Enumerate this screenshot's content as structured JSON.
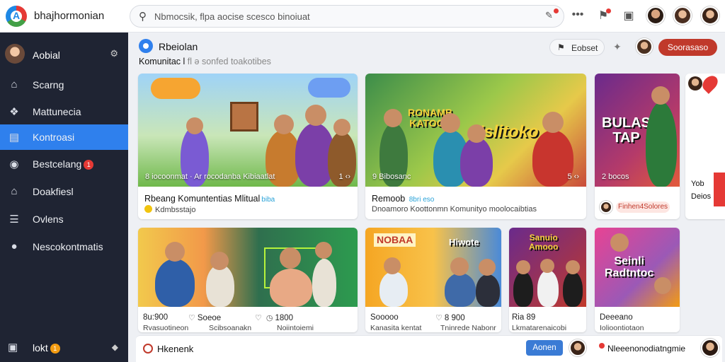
{
  "app": {
    "title": "bhajhormonian",
    "logo_letter": "A"
  },
  "search": {
    "value": "Nbmocsik, flpa aocise scesco binoiuat"
  },
  "sidebar": {
    "user_label": "Aobial",
    "items": [
      {
        "label": "Scarng",
        "icon": "home-icon"
      },
      {
        "label": "Mattunecia",
        "icon": "puzzle-icon"
      },
      {
        "label": "Kontroasi",
        "icon": "square-icon",
        "active": true
      },
      {
        "label": "Bestcelang",
        "icon": "camera-icon",
        "badge": "1"
      },
      {
        "label": "Doakfiesl",
        "icon": "house-icon"
      },
      {
        "label": "Ovlens",
        "icon": "list-icon"
      },
      {
        "label": "Nescokontmatis",
        "icon": "group-icon"
      }
    ],
    "bottom": {
      "label": "lokt",
      "badge": "1"
    }
  },
  "main": {
    "title": "Rbeiolan",
    "subtitle": "Komunitac l",
    "subtitle_muted": "fl ə sonfed toakotibes",
    "secondary_button": "Eobset",
    "primary_button": "Soorasaso"
  },
  "cards_row1": [
    {
      "caption": "8 iocoonmat · Ar rocodanba Kibiaatlat",
      "badge": "1 ‹›",
      "title": "Rbeang Komuntentias Mlitual",
      "tag": "biba",
      "meta": "Kdmbsstajo"
    },
    {
      "caption": "9 Bibosanc",
      "badge": "5 ‹›",
      "title": "Remoob",
      "tag": "8bri eso",
      "meta": "Dnoamoro Koottonmn Komunityo moolocaibtias",
      "overlay": "Nslitoko",
      "overlay2": "RONAMB\nKATOCK"
    },
    {
      "caption": "2 bocos",
      "badge": "",
      "title": "Finhen4Solores",
      "tag": "",
      "meta": "",
      "overlay": "BULAS\nTAP"
    }
  ],
  "side_panel": {
    "line1": "Yob",
    "line2": "Deios"
  },
  "cards_row2": [
    {
      "stat": "8u:900",
      "sub": "Rvasuotineon",
      "stat2": "Soeoe",
      "sub2": "Scibsoanakn",
      "stat3": "1800",
      "sub3": "Noiintoiemi"
    },
    {
      "stat": "Sooooo",
      "sub": "Kanasita kentat",
      "stat2": "8 900",
      "sub2": "Tninrede Nabonr",
      "overlay": "NOBAA",
      "overlay2": "Hiwote"
    },
    {
      "stat": "Ria 89",
      "sub": "Lkmatarenaicobi",
      "overlay": "Sanuio\nAmooo"
    },
    {
      "stat": "Deeeano",
      "sub": "Iolioontiotaon",
      "overlay": "Seinli\nRadtntoc"
    }
  ],
  "bottombar": {
    "label": "Hkenenk",
    "button": "Aonen",
    "chat_text": "Nleeenonodiatngmie"
  },
  "colors": {
    "accent": "#2f80ed",
    "primary_button": "#c0392b",
    "sidebar_bg": "#1f2433"
  }
}
